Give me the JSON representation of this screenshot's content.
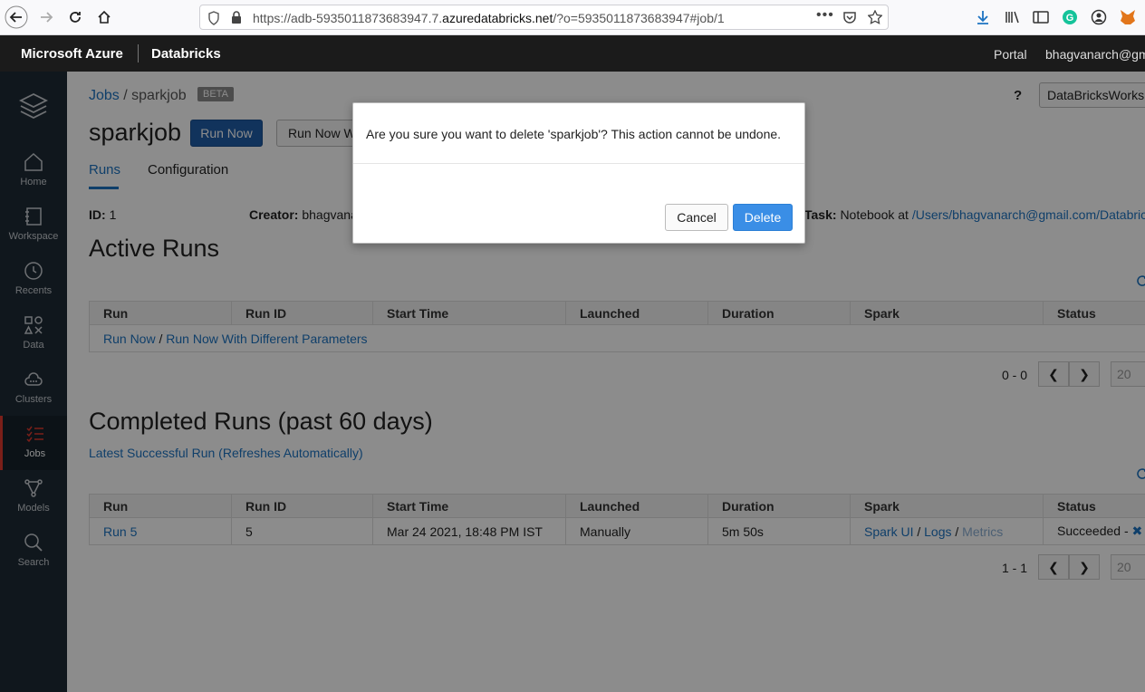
{
  "browser": {
    "url_prefix": "https://adb-5935011873683947.7.",
    "url_domain": "azuredatabricks.net",
    "url_suffix": "/?o=5935011873683947#job/1"
  },
  "topbar": {
    "brand": "Microsoft Azure",
    "product": "Databricks",
    "portal_label": "Portal",
    "user": "bhagvanarch@gm"
  },
  "sidebar": {
    "items": [
      {
        "label": "Home"
      },
      {
        "label": "Workspace"
      },
      {
        "label": "Recents"
      },
      {
        "label": "Data"
      },
      {
        "label": "Clusters"
      },
      {
        "label": "Jobs"
      },
      {
        "label": "Models"
      },
      {
        "label": "Search"
      }
    ]
  },
  "header": {
    "breadcrumb_root": "Jobs",
    "breadcrumb_sep": " / ",
    "breadcrumb_current": "sparkjob",
    "beta": "BETA",
    "help": "?",
    "workspace": "DataBricksWorks",
    "job_title": "sparkjob",
    "run_now": "Run Now",
    "run_now_with": "Run Now Wi"
  },
  "tabs": [
    {
      "label": "Runs",
      "active": true
    },
    {
      "label": "Configuration",
      "active": false
    }
  ],
  "meta": {
    "id_label": "ID:",
    "id_value": "1",
    "creator_label": "Creator:",
    "creator_value": "bhagvana",
    "task_label": "Task:",
    "task_value": "Notebook at ",
    "task_link": "/Users/bhagvanarch@gmail.com/Databric"
  },
  "active_runs": {
    "title": "Active Runs",
    "columns": [
      "Run",
      "Run ID",
      "Start Time",
      "Launched",
      "Duration",
      "Spark",
      "Status"
    ],
    "run_now_link": "Run Now",
    "link_sep": " / ",
    "run_diff_link": "Run Now With Different Parameters",
    "pager": "0 - 0",
    "page_size": "20"
  },
  "completed_runs": {
    "title": "Completed Runs (past 60 days)",
    "latest_link": "Latest Successful Run (Refreshes Automatically)",
    "columns": [
      "Run",
      "Run ID",
      "Start Time",
      "Launched",
      "Duration",
      "Spark",
      "Status"
    ],
    "rows": [
      {
        "run": "Run 5",
        "run_id": "5",
        "start_time": "Mar 24 2021, 18:48 PM IST",
        "launched": "Manually",
        "duration": "5m 50s",
        "spark_ui": "Spark UI",
        "logs": "Logs",
        "metrics": "Metrics",
        "sep": " / ",
        "status": "Succeeded - "
      }
    ],
    "pager": "1 - 1",
    "page_size": "20"
  },
  "modal": {
    "message": "Are you sure you want to delete 'sparkjob'? This action cannot be undone.",
    "cancel": "Cancel",
    "delete": "Delete"
  },
  "colors": {
    "link": "#1d73c2",
    "primary": "#1f5da8",
    "delete_button": "#3a8ee6",
    "sidebar": "#1e2b36",
    "active_marker": "#e03a2f"
  }
}
